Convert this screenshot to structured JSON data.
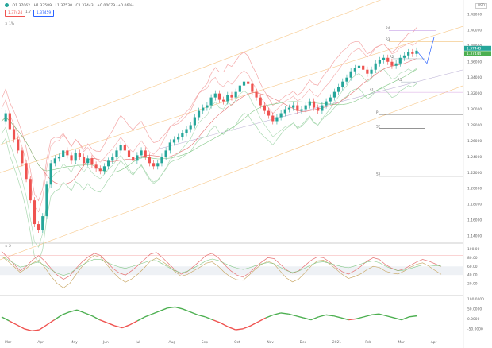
{
  "header": {
    "ohlc_items": [
      "O1.37062",
      "H1.37589",
      "L1.37530",
      "C1.37443",
      "+0.00079 (+0.06%)"
    ],
    "price_box_left": "1.37424",
    "spread": "1.7",
    "price_box_right": "1.37459",
    "currency": "USD",
    "indicator1_label": "× 1%",
    "indicator2_label": "× 2"
  },
  "colors": {
    "up": "#26a69a",
    "down": "#ef5350",
    "upper_band": "#f4a8a8",
    "lower_band": "#a8d8b0",
    "channel": "#f7c88a",
    "purple_line": "#d6a3e0"
  },
  "chart_data": [
    {
      "type": "line",
      "x": [
        "Mar",
        "Apr",
        "May",
        "Jun",
        "Jul",
        "Aug",
        "Sep",
        "Oct",
        "Nov",
        "Dec",
        "2021",
        "Feb",
        "Mar",
        "Apr"
      ],
      "yticks": [
        "1.42000",
        "1.40000",
        "1.38000",
        "1.36000",
        "1.34000",
        "1.32000",
        "1.30000",
        "1.28000",
        "1.26000",
        "1.24000",
        "1.22000",
        "1.20000",
        "1.18000",
        "1.16000",
        "1.14000"
      ],
      "ylim": [
        1.135,
        1.43
      ],
      "close": [
        1.285,
        1.295,
        1.275,
        1.262,
        1.248,
        1.232,
        1.212,
        1.185,
        1.155,
        1.148,
        1.165,
        1.205,
        1.232,
        1.238,
        1.24,
        1.248,
        1.242,
        1.235,
        1.245,
        1.24,
        1.232,
        1.238,
        1.23,
        1.225,
        1.222,
        1.228,
        1.235,
        1.24,
        1.248,
        1.255,
        1.248,
        1.24,
        1.235,
        1.242,
        1.248,
        1.24,
        1.232,
        1.228,
        1.232,
        1.24,
        1.248,
        1.258,
        1.262,
        1.265,
        1.27,
        1.275,
        1.28,
        1.29,
        1.298,
        1.302,
        1.305,
        1.315,
        1.32,
        1.312,
        1.31,
        1.318,
        1.315,
        1.322,
        1.33,
        1.335,
        1.332,
        1.322,
        1.315,
        1.305,
        1.298,
        1.292,
        1.285,
        1.29,
        1.295,
        1.3,
        1.302,
        1.305,
        1.298,
        1.3,
        1.305,
        1.31,
        1.302,
        1.298,
        1.305,
        1.31,
        1.315,
        1.322,
        1.328,
        1.335,
        1.34,
        1.348,
        1.352,
        1.355,
        1.35,
        1.345,
        1.35,
        1.358,
        1.362,
        1.365,
        1.36,
        1.355,
        1.358,
        1.365,
        1.368,
        1.372,
        1.37,
        1.374
      ],
      "annotations": [
        "R4",
        "R3",
        "R2",
        "R1",
        "P",
        "S1",
        "S2",
        "S3"
      ],
      "last_price": "1.37443",
      "price_tags": [
        "1.37443",
        "1.37444"
      ]
    },
    {
      "type": "line",
      "yticks": [
        "100.00",
        "80.00",
        "60.00",
        "40.00",
        "20.00"
      ],
      "ylim": [
        0,
        110
      ]
    },
    {
      "type": "area",
      "yticks": [
        "100.0000",
        "50.0000",
        "0.0000",
        "-50.0000"
      ],
      "ylim": [
        -75,
        110
      ]
    }
  ]
}
